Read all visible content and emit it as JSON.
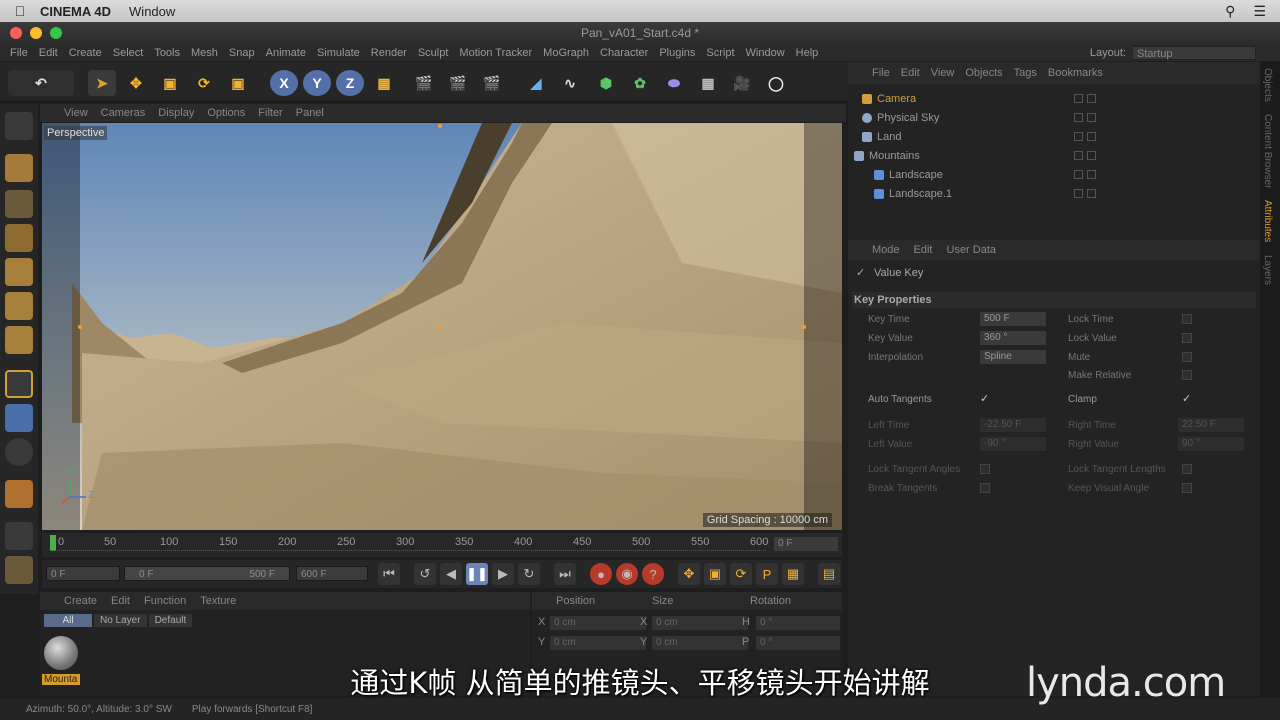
{
  "mac_menu": {
    "app": "CINEMA 4D",
    "window": "Window"
  },
  "window": {
    "title": "Pan_vA01_Start.c4d *"
  },
  "menus": [
    "File",
    "Edit",
    "Create",
    "Select",
    "Tools",
    "Mesh",
    "Snap",
    "Animate",
    "Simulate",
    "Render",
    "Sculpt",
    "Motion Tracker",
    "MoGraph",
    "Character",
    "Plugins",
    "Script",
    "Window",
    "Help"
  ],
  "layout": {
    "label": "Layout:",
    "value": "Startup"
  },
  "viewport": {
    "menus": [
      "View",
      "Cameras",
      "Display",
      "Options",
      "Filter",
      "Panel"
    ],
    "label": "Perspective",
    "grid_spacing": "Grid Spacing : 10000 cm",
    "axis": {
      "y": "Y",
      "z": "Z"
    }
  },
  "timeline": {
    "ticks": [
      "0",
      "50",
      "100",
      "150",
      "200",
      "250",
      "300",
      "350",
      "400",
      "450",
      "500",
      "550",
      "600"
    ],
    "current_frame": "0 F",
    "start": "0 F",
    "range_start": "0 F",
    "range_end": "500 F",
    "end": "600 F"
  },
  "material_manager": {
    "menus": [
      "Create",
      "Edit",
      "Function",
      "Texture"
    ],
    "filters": [
      "All",
      "No Layer",
      "Default"
    ],
    "material": "Mounta"
  },
  "coordinates": {
    "headers": [
      "Position",
      "Size",
      "Rotation"
    ],
    "rows": [
      {
        "axis": "X",
        "pos": "0 cm",
        "size_axis": "X",
        "size": "0 cm",
        "rot_axis": "H",
        "rot": "0 °"
      },
      {
        "axis": "Y",
        "pos": "0 cm",
        "size_axis": "Y",
        "size": "0 cm",
        "rot_axis": "P",
        "rot": "0 °"
      }
    ]
  },
  "object_manager": {
    "menus": [
      "File",
      "Edit",
      "View",
      "Objects",
      "Tags",
      "Bookmarks"
    ],
    "objects": [
      {
        "name": "Camera",
        "color": "#d2a03a"
      },
      {
        "name": "Physical Sky",
        "color": "#8fa8c8"
      },
      {
        "name": "Land",
        "color": "#8fa8c8"
      },
      {
        "name": "Mountains",
        "color": "#8fa8c8"
      },
      {
        "name": "Landscape",
        "color": "#5f8fd8"
      },
      {
        "name": "Landscape.1",
        "color": "#5f8fd8"
      }
    ]
  },
  "attributes": {
    "menus": [
      "Mode",
      "Edit",
      "User Data"
    ],
    "title": "Value Key",
    "section": "Key Properties",
    "left_props": [
      {
        "label": "Key Time",
        "value": "500 F"
      },
      {
        "label": "Key Value",
        "value": "360 °"
      },
      {
        "label": "Interpolation",
        "value": "Spline"
      }
    ],
    "right_props": [
      "Lock Time",
      "Lock Value",
      "Mute",
      "Make Relative"
    ],
    "auto_tangents": "Auto Tangents",
    "clamp": "Clamp",
    "left_time": {
      "label": "Left Time",
      "value": "-22.50 F"
    },
    "left_value": {
      "label": "Left Value",
      "value": "-90 °"
    },
    "right_time": {
      "label": "Right Time",
      "value": "22.50 F"
    },
    "right_value": {
      "label": "Right Value",
      "value": "90 °"
    },
    "lock_tangent_angles": "Lock Tangent Angles",
    "lock_tangent_lengths": "Lock Tangent Lengths",
    "break_tangents": "Break Tangents",
    "keep_visual_angle": "Keep Visual Angle"
  },
  "side_tabs": [
    "Objects",
    "Content Browser",
    "Attributes",
    "Layers"
  ],
  "status": {
    "left": "Azimuth: 50.0°, Altitude: 3.0° SW",
    "right": "Play forwards [Shortcut F8]"
  },
  "subtitle": "通过K帧 从简单的推镜头、平移镜头开始讲解",
  "brand": "lynda.com",
  "colors": {
    "accent": "#d89c2a",
    "sky_top": "#6f93bf",
    "sand": "#b7a07a"
  }
}
